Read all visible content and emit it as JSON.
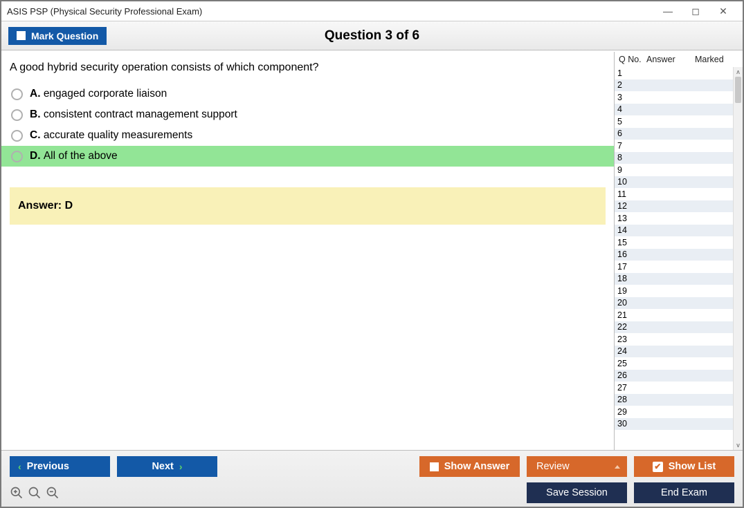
{
  "window": {
    "title": "ASIS PSP (Physical Security Professional Exam)"
  },
  "header": {
    "mark_label": "Mark Question",
    "question_title": "Question 3 of 6"
  },
  "question": {
    "text": "A good hybrid security operation consists of which component?",
    "options": [
      {
        "letter": "A.",
        "text": "engaged corporate liaison",
        "correct": false
      },
      {
        "letter": "B.",
        "text": "consistent contract management support",
        "correct": false
      },
      {
        "letter": "C.",
        "text": "accurate quality measurements",
        "correct": false
      },
      {
        "letter": "D.",
        "text": "All of the above",
        "correct": true
      }
    ],
    "answer_label": "Answer: D"
  },
  "sidebar": {
    "col_qno": "Q No.",
    "col_answer": "Answer",
    "col_marked": "Marked",
    "rows": [
      1,
      2,
      3,
      4,
      5,
      6,
      7,
      8,
      9,
      10,
      11,
      12,
      13,
      14,
      15,
      16,
      17,
      18,
      19,
      20,
      21,
      22,
      23,
      24,
      25,
      26,
      27,
      28,
      29,
      30
    ]
  },
  "footer": {
    "previous": "Previous",
    "next": "Next",
    "show_answer": "Show Answer",
    "review": "Review",
    "show_list": "Show List",
    "save_session": "Save Session",
    "end_exam": "End Exam"
  }
}
